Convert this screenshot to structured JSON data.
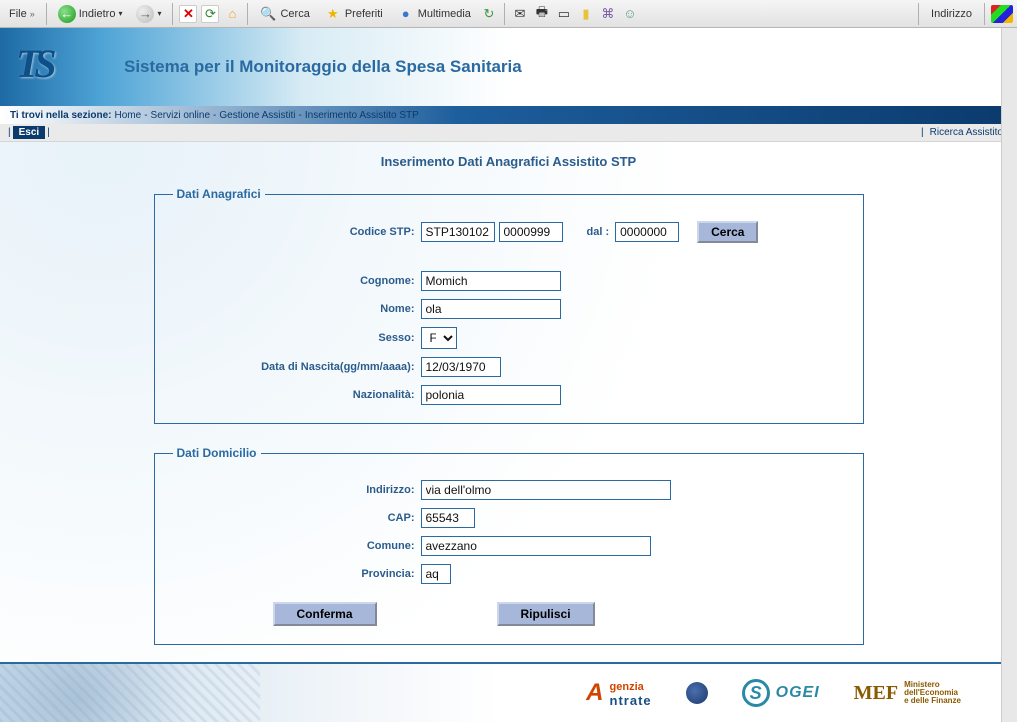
{
  "toolbar": {
    "file_label": "File",
    "back_label": "Indietro",
    "search_label": "Cerca",
    "favorites_label": "Preferiti",
    "multimedia_label": "Multimedia",
    "address_label": "Indirizzo"
  },
  "header": {
    "title": "Sistema per il Monitoraggio della Spesa Sanitaria"
  },
  "breadcrumb": {
    "prefix": "Ti trovi nella sezione:",
    "items": [
      "Home",
      "Servizi online",
      "Gestione Assistiti",
      "Inserimento Assistito STP"
    ]
  },
  "subbar": {
    "esci": "Esci",
    "ricerca": "Ricerca Assistito"
  },
  "page": {
    "title": "Inserimento Dati Anagrafici Assistito STP"
  },
  "fieldsets": {
    "anagrafici": {
      "legend": "Dati Anagrafici",
      "labels": {
        "codice_stp": "Codice STP:",
        "dal": "dal :",
        "cerca": "Cerca",
        "cognome": "Cognome:",
        "nome": "Nome:",
        "sesso": "Sesso:",
        "data_nascita": "Data di Nascita(gg/mm/aaaa):",
        "nazionalita": "Nazionalità:"
      },
      "values": {
        "stp1": "STP130102",
        "stp2": "0000999",
        "dal": "0000000",
        "cognome": "Momich",
        "nome": "ola",
        "sesso": "F",
        "data_nascita": "12/03/1970",
        "nazionalita": "polonia"
      }
    },
    "domicilio": {
      "legend": "Dati Domicilio",
      "labels": {
        "indirizzo": "Indirizzo:",
        "cap": "CAP:",
        "comune": "Comune:",
        "provincia": "Provincia:"
      },
      "values": {
        "indirizzo": "via dell'olmo",
        "cap": "65543",
        "comune": "avezzano",
        "provincia": "aq"
      }
    }
  },
  "buttons": {
    "conferma": "Conferma",
    "ripulisci": "Ripulisci"
  },
  "footer": {
    "agenzia1": "genzia",
    "agenzia2": "ntrate",
    "sogei": "OGEI",
    "mef": "MEF",
    "mef_sub1": "Ministero",
    "mef_sub2": "dell'Economia",
    "mef_sub3": "e delle Finanze"
  }
}
